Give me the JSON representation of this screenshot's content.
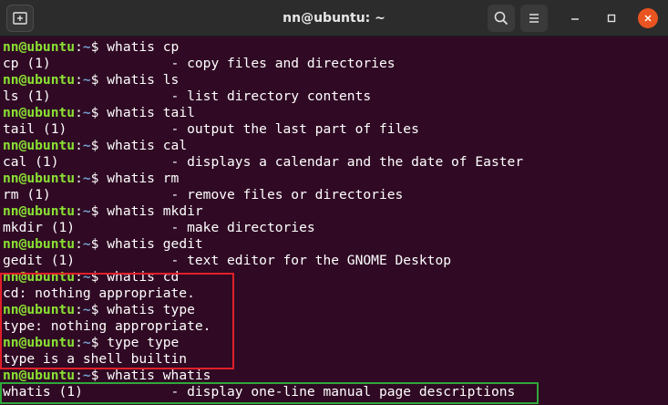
{
  "window": {
    "title": "nn@ubuntu: ~"
  },
  "icons": {
    "new_tab": "new-tab-icon",
    "search": "search-icon",
    "menu": "hamburger-menu-icon",
    "minimize": "minimize-icon",
    "maximize": "maximize-icon",
    "close": "close-icon"
  },
  "colors": {
    "terminal_bg": "#300a24",
    "prompt_user": "#8ae234",
    "prompt_path": "#729fcf",
    "close_button": "#e95420",
    "highlight_red": "#e0202a",
    "highlight_green": "#2fa83a"
  },
  "prompt": {
    "user": "nn@ubuntu",
    "sep": ":",
    "path": "~",
    "symbol": "$ "
  },
  "lines": [
    {
      "prompt": true,
      "cmd": "whatis cp"
    },
    {
      "text": "cp (1)               - copy files and directories"
    },
    {
      "prompt": true,
      "cmd": "whatis ls"
    },
    {
      "text": "ls (1)               - list directory contents"
    },
    {
      "prompt": true,
      "cmd": "whatis tail"
    },
    {
      "text": "tail (1)             - output the last part of files"
    },
    {
      "prompt": true,
      "cmd": "whatis cal"
    },
    {
      "text": "cal (1)              - displays a calendar and the date of Easter"
    },
    {
      "prompt": true,
      "cmd": "whatis rm"
    },
    {
      "text": "rm (1)               - remove files or directories"
    },
    {
      "prompt": true,
      "cmd": "whatis mkdir"
    },
    {
      "text": "mkdir (1)            - make directories"
    },
    {
      "prompt": true,
      "cmd": "whatis gedit"
    },
    {
      "text": "gedit (1)            - text editor for the GNOME Desktop"
    },
    {
      "prompt": true,
      "cmd": "whatis cd"
    },
    {
      "text": "cd: nothing appropriate."
    },
    {
      "prompt": true,
      "cmd": "whatis type"
    },
    {
      "text": "type: nothing appropriate."
    },
    {
      "prompt": true,
      "cmd": "type type"
    },
    {
      "text": "type is a shell builtin"
    },
    {
      "prompt": true,
      "cmd": "whatis whatis"
    },
    {
      "text": "whatis (1)           - display one-line manual page descriptions"
    }
  ]
}
